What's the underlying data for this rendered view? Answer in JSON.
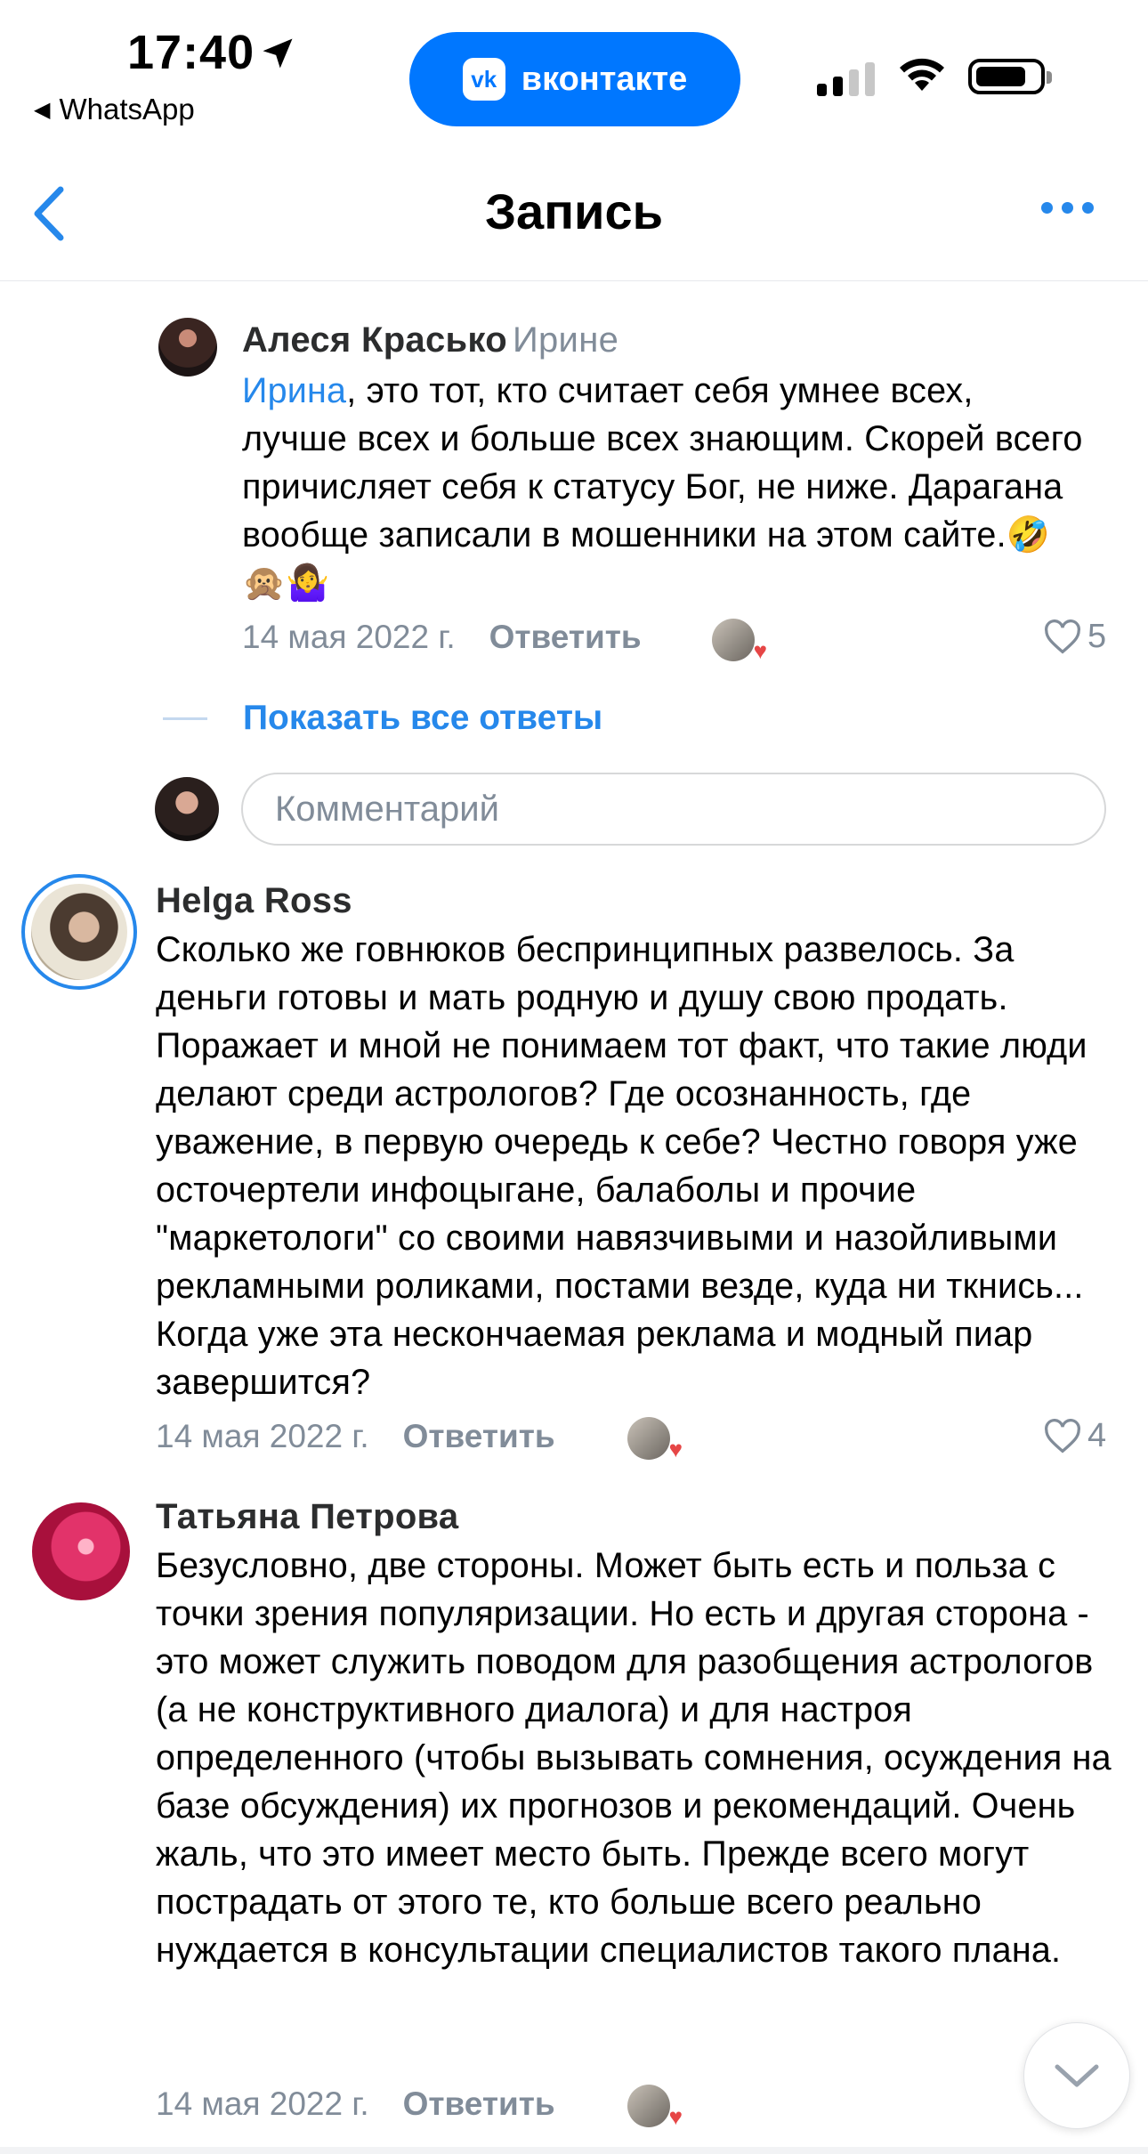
{
  "status_bar": {
    "time": "17:40",
    "back_app": "WhatsApp",
    "pill_label": "вконтакте",
    "pill_logo": "vk",
    "pill_color": "#0077ff"
  },
  "nav": {
    "title": "Запись",
    "accent": "#2688eb"
  },
  "comments": [
    {
      "author": "Алеся Красько",
      "reply_to": "Ирине",
      "mention": "Ирина",
      "text": ", это тот, кто считает себя умнее всех, лучше всех и больше всех знающим. Скорей всего причисляет себя к статусу Бог, не ниже. Дарагана вообще записали в мошенники на этом сайте.🤣 🙊🤷‍♀️",
      "date": "14 мая 2022 г.",
      "reply_label": "Ответить",
      "likes": "5"
    },
    {
      "author": "Helga Ross",
      "text": "Сколько же говнюков беспринципных развелось. За деньги готовы и мать родную и душу свою продать. Поражает и мной не понимаем тот факт, что такие люди делают среди астрологов? Где осознанность, где уважение, в первую очередь к себе? Честно говоря уже осточертели инфоцыгане, балаболы и прочие \"маркетологи\" со своими навязчивыми и назойливыми рекламными роликами, постами везде, куда ни ткнись... Когда уже эта несконча­емая реклама и модный пиар завершится?",
      "date": "14 мая 2022 г.",
      "reply_label": "Ответить",
      "likes": "4"
    },
    {
      "author": "Татьяна Петрова",
      "text": "Безусловно, две стороны. Может быть есть и польза с точки зрения популяризации. Но есть и другая сторона - это может служить поводом для разобщения  астрологов (а не конструктивного диалога) и для настроя определенного (чтобы вызывать сомнения, осуждения на базе обсуждения) их прогнозов и рекомендаций. Очень жаль, что это имеет место быть. Прежде всего могут пострадать от этого те, кто больше всего реально нуждается в консультации специалистов такого плана.",
      "date": "14 мая 2022 г.",
      "reply_label": "Ответить"
    }
  ],
  "show_all_replies": "Показать все ответы",
  "comment_input": {
    "placeholder": "Комментарий"
  }
}
